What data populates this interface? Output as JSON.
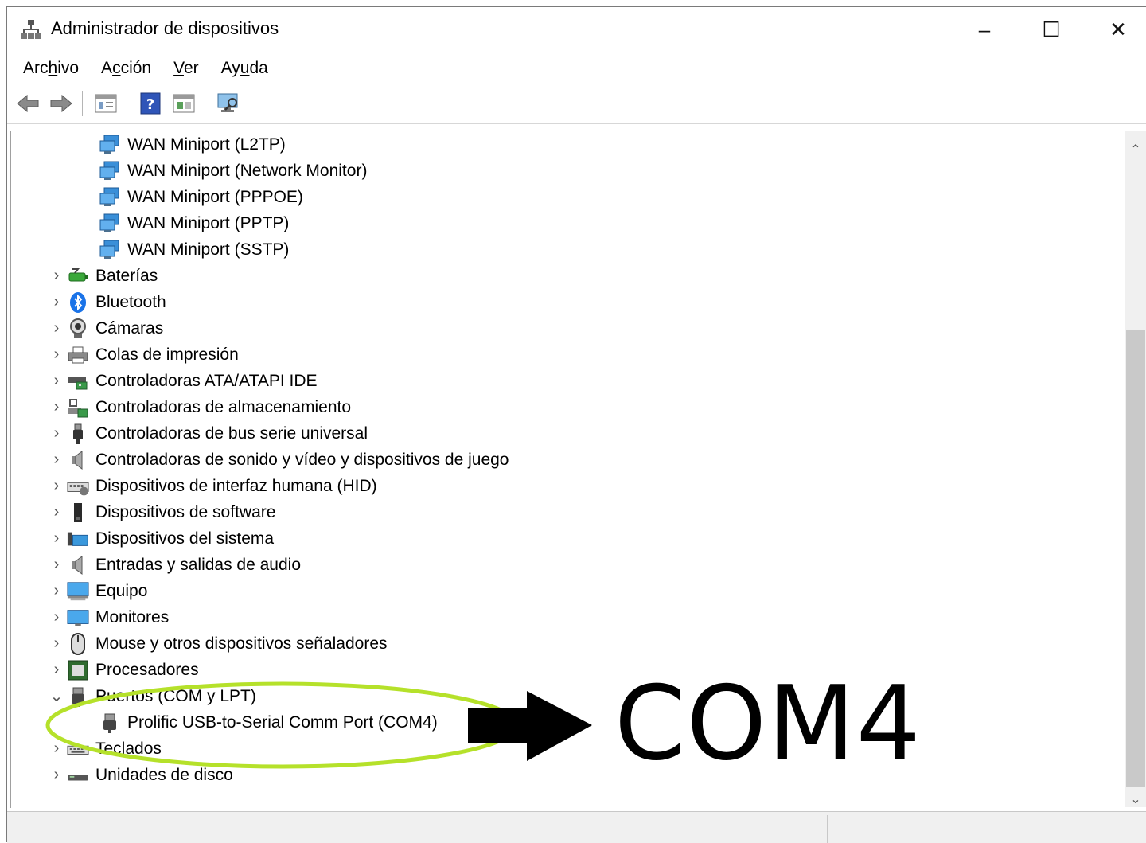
{
  "window": {
    "title": "Administrador de dispositivos",
    "controls": {
      "minimize": "–",
      "maximize": "☐",
      "close": "✕"
    }
  },
  "menu": [
    {
      "pre": "Arc",
      "mnemonic": "h",
      "post": "ivo"
    },
    {
      "pre": "A",
      "mnemonic": "c",
      "post": "ción"
    },
    {
      "pre": "",
      "mnemonic": "V",
      "post": "er"
    },
    {
      "pre": "Ay",
      "mnemonic": "u",
      "post": "da"
    }
  ],
  "toolbar": [
    "back-icon",
    "forward-icon",
    "properties-icon",
    "help-icon",
    "update-driver-icon",
    "scan-hardware-icon"
  ],
  "tree": {
    "wan_items": [
      "WAN Miniport (L2TP)",
      "WAN Miniport (Network Monitor)",
      "WAN Miniport (PPPOE)",
      "WAN Miniport (PPTP)",
      "WAN Miniport (SSTP)"
    ],
    "categories": [
      {
        "label": "Baterías",
        "icon": "battery-icon"
      },
      {
        "label": "Bluetooth",
        "icon": "bluetooth-icon"
      },
      {
        "label": "Cámaras",
        "icon": "camera-icon"
      },
      {
        "label": "Colas de impresión",
        "icon": "printer-icon"
      },
      {
        "label": "Controladoras ATA/ATAPI IDE",
        "icon": "ide-controller-icon"
      },
      {
        "label": "Controladoras de almacenamiento",
        "icon": "storage-controller-icon"
      },
      {
        "label": "Controladoras de bus serie universal",
        "icon": "usb-icon"
      },
      {
        "label": "Controladoras de sonido y vídeo y dispositivos de juego",
        "icon": "speaker-icon"
      },
      {
        "label": "Dispositivos de interfaz humana (HID)",
        "icon": "hid-icon"
      },
      {
        "label": "Dispositivos de software",
        "icon": "software-device-icon"
      },
      {
        "label": "Dispositivos del sistema",
        "icon": "system-folder-icon"
      },
      {
        "label": "Entradas y salidas de audio",
        "icon": "speaker-icon"
      },
      {
        "label": "Equipo",
        "icon": "computer-icon"
      },
      {
        "label": "Monitores",
        "icon": "monitor-icon"
      },
      {
        "label": "Mouse y otros dispositivos señaladores",
        "icon": "mouse-icon"
      },
      {
        "label": "Procesadores",
        "icon": "processor-icon"
      },
      {
        "label": "Puertos (COM y LPT)",
        "icon": "port-icon",
        "expanded": true
      },
      {
        "label": "Teclados",
        "icon": "keyboard-icon"
      },
      {
        "label": "Unidades de disco",
        "icon": "disk-drive-icon"
      }
    ],
    "port_child": "Prolific USB-to-Serial Comm Port (COM4)"
  },
  "annotation": {
    "text": "COM4",
    "ellipse_color": "#b5e12a",
    "arrow_color": "#000000"
  }
}
